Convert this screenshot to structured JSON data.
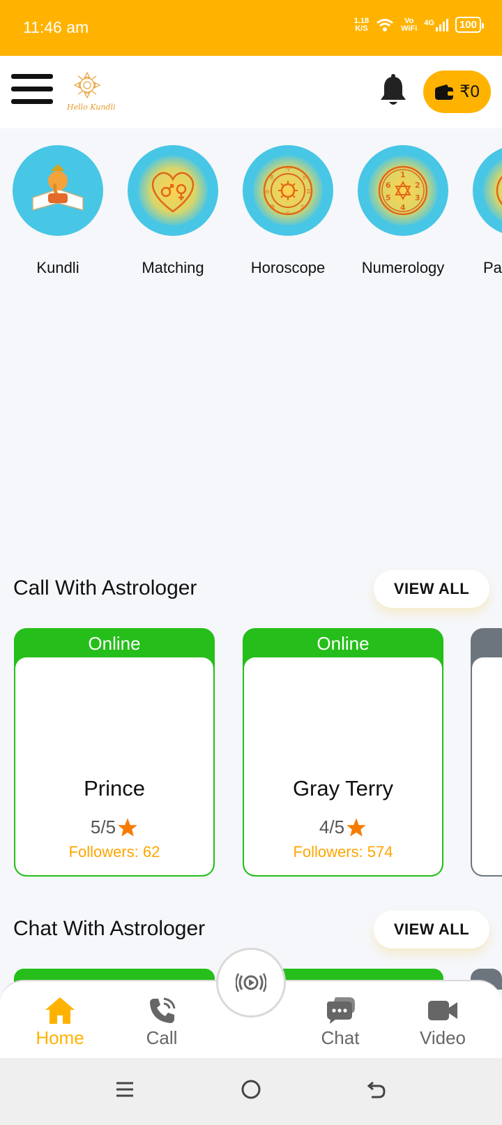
{
  "status_bar": {
    "time": "11:46 am",
    "net_speed_value": "1.18",
    "net_speed_unit": "K/S",
    "vowifi_top": "Vo",
    "vowifi_bottom": "WiFi",
    "network": "4G",
    "battery": "100"
  },
  "header": {
    "logo_text": "Hello Kundli",
    "wallet_amount": "₹0"
  },
  "categories": [
    {
      "label": "Kundli",
      "icon": "ganesha-icon"
    },
    {
      "label": "Matching",
      "icon": "heart-gender-icon"
    },
    {
      "label": "Horoscope",
      "icon": "zodiac-wheel-icon"
    },
    {
      "label": "Numerology",
      "icon": "numerology-icon"
    },
    {
      "label": "Pa",
      "icon": "panchang-icon"
    }
  ],
  "call_section": {
    "title": "Call With Astrologer",
    "view_all": "VIEW ALL",
    "cards": [
      {
        "status": "Online",
        "name": "Prince",
        "rating": "5/5",
        "followers": "Followers: 62"
      },
      {
        "status": "Online",
        "name": "Gray Terry",
        "rating": "4/5",
        "followers": "Followers: 574"
      }
    ]
  },
  "chat_section": {
    "title": "Chat With Astrologer",
    "view_all": "VIEW ALL"
  },
  "bottom_nav": {
    "items": [
      {
        "label": "Home",
        "icon": "home-icon"
      },
      {
        "label": "Call",
        "icon": "phone-icon"
      },
      {
        "label": "Chat",
        "icon": "chat-icon"
      },
      {
        "label": "Video",
        "icon": "video-icon"
      }
    ],
    "active": "Home"
  },
  "colors": {
    "accent": "#ffb300",
    "online": "#25be1a",
    "category_bg": "#48c6e6",
    "followers": "#ffa500"
  }
}
